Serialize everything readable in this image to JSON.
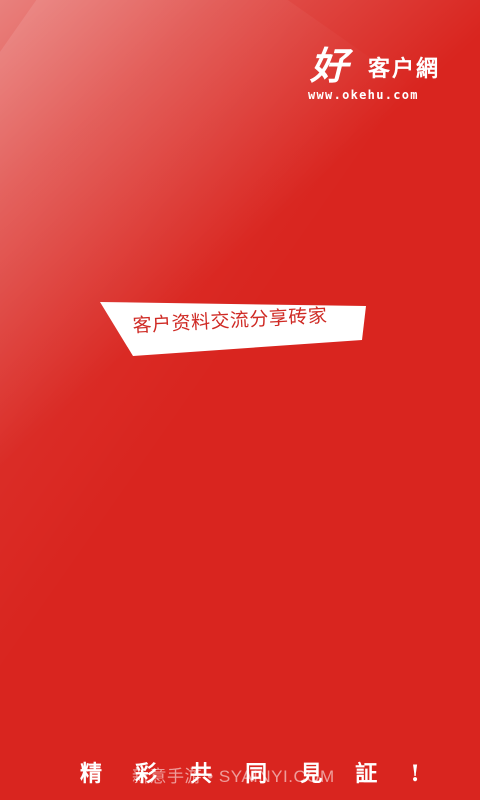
{
  "logo": {
    "mark": "好",
    "name": "客户網",
    "url": "www.okehu.com"
  },
  "banner": {
    "text": "客户资料交流分享砖家"
  },
  "slogan": {
    "chars": [
      "精",
      "彩",
      "共",
      "同",
      "見",
      "証",
      "!"
    ]
  },
  "watermark": {
    "text": "新意手游 • SYAINYI.COM"
  },
  "colors": {
    "background": "#d9251f",
    "banner_bg": "#ffffff",
    "banner_text": "#cf2a24",
    "logo": "#ffffff"
  }
}
